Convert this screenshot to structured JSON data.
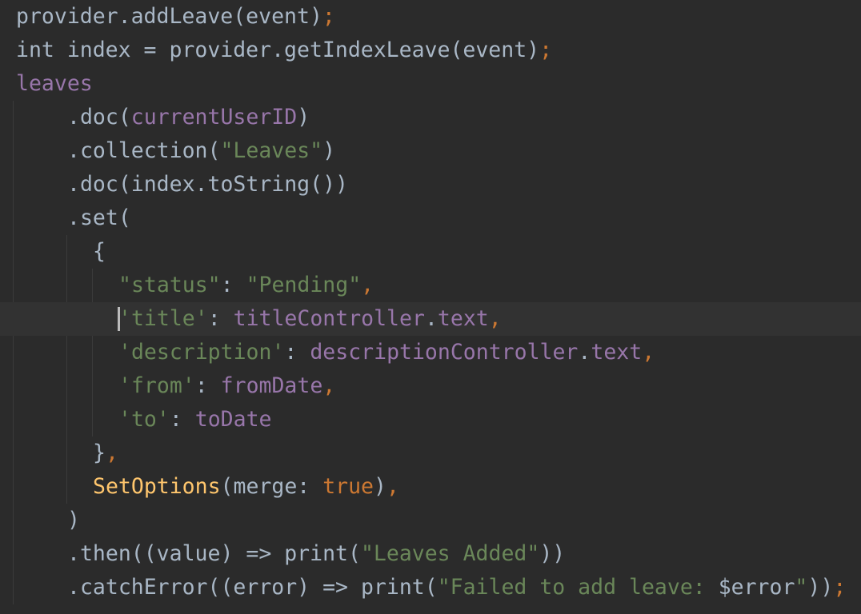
{
  "editor": {
    "theme": "dark",
    "colors": {
      "background": "#2b2b2b",
      "current_line": "#323232",
      "text": "#a9b7c6",
      "field": "#9876aa",
      "string": "#6a8759",
      "punctuation": "#cc7832",
      "class": "#ffc66d"
    },
    "current_line_index": 9,
    "lines": [
      {
        "indent": 0,
        "tokens": [
          {
            "t": "provider.addLeave(event)",
            "c": "plain"
          },
          {
            "t": ";",
            "c": "punct"
          }
        ]
      },
      {
        "indent": 0,
        "tokens": [
          {
            "t": "int index = provider.getIndexLeave(event)",
            "c": "plain"
          },
          {
            "t": ";",
            "c": "punct"
          }
        ]
      },
      {
        "indent": 0,
        "tokens": [
          {
            "t": "leaves",
            "c": "field"
          }
        ]
      },
      {
        "indent": 4,
        "tokens": [
          {
            "t": ".doc(",
            "c": "plain"
          },
          {
            "t": "currentUserID",
            "c": "field"
          },
          {
            "t": ")",
            "c": "plain"
          }
        ]
      },
      {
        "indent": 4,
        "tokens": [
          {
            "t": ".collection(",
            "c": "plain"
          },
          {
            "t": "\"Leaves\"",
            "c": "str"
          },
          {
            "t": ")",
            "c": "plain"
          }
        ]
      },
      {
        "indent": 4,
        "tokens": [
          {
            "t": ".doc(index.toString())",
            "c": "plain"
          }
        ]
      },
      {
        "indent": 4,
        "tokens": [
          {
            "t": ".set(",
            "c": "plain"
          }
        ]
      },
      {
        "indent": 6,
        "tokens": [
          {
            "t": "{",
            "c": "plain"
          }
        ]
      },
      {
        "indent": 8,
        "tokens": [
          {
            "t": "\"status\"",
            "c": "str"
          },
          {
            "t": ": ",
            "c": "plain"
          },
          {
            "t": "\"Pending\"",
            "c": "str"
          },
          {
            "t": ",",
            "c": "punct"
          }
        ]
      },
      {
        "indent": 8,
        "tokens": [
          {
            "t": "'title'",
            "c": "str"
          },
          {
            "t": ": ",
            "c": "plain"
          },
          {
            "t": "titleController",
            "c": "field"
          },
          {
            "t": ".",
            "c": "plain"
          },
          {
            "t": "text",
            "c": "field"
          },
          {
            "t": ",",
            "c": "punct"
          }
        ]
      },
      {
        "indent": 8,
        "tokens": [
          {
            "t": "'description'",
            "c": "str"
          },
          {
            "t": ": ",
            "c": "plain"
          },
          {
            "t": "descriptionController",
            "c": "field"
          },
          {
            "t": ".",
            "c": "plain"
          },
          {
            "t": "text",
            "c": "field"
          },
          {
            "t": ",",
            "c": "punct"
          }
        ]
      },
      {
        "indent": 8,
        "tokens": [
          {
            "t": "'from'",
            "c": "str"
          },
          {
            "t": ": ",
            "c": "plain"
          },
          {
            "t": "fromDate",
            "c": "field"
          },
          {
            "t": ",",
            "c": "punct"
          }
        ]
      },
      {
        "indent": 8,
        "tokens": [
          {
            "t": "'to'",
            "c": "str"
          },
          {
            "t": ": ",
            "c": "plain"
          },
          {
            "t": "toDate",
            "c": "field"
          }
        ]
      },
      {
        "indent": 6,
        "tokens": [
          {
            "t": "}",
            "c": "plain"
          },
          {
            "t": ",",
            "c": "punct"
          }
        ]
      },
      {
        "indent": 6,
        "tokens": [
          {
            "t": "SetOptions",
            "c": "cls"
          },
          {
            "t": "(merge: ",
            "c": "plain"
          },
          {
            "t": "true",
            "c": "kw"
          },
          {
            "t": ")",
            "c": "plain"
          },
          {
            "t": ",",
            "c": "punct"
          }
        ]
      },
      {
        "indent": 4,
        "tokens": [
          {
            "t": ")",
            "c": "plain"
          }
        ]
      },
      {
        "indent": 4,
        "tokens": [
          {
            "t": ".then((value) => print(",
            "c": "plain"
          },
          {
            "t": "\"Leaves Added\"",
            "c": "str"
          },
          {
            "t": "))",
            "c": "plain"
          }
        ]
      },
      {
        "indent": 4,
        "tokens": [
          {
            "t": ".catchError((error) => print(",
            "c": "plain"
          },
          {
            "t": "\"Failed to add leave: ",
            "c": "str"
          },
          {
            "t": "$error",
            "c": "plain"
          },
          {
            "t": "\"",
            "c": "str"
          },
          {
            "t": "))",
            "c": "plain"
          },
          {
            "t": ";",
            "c": "punct"
          }
        ]
      }
    ]
  }
}
